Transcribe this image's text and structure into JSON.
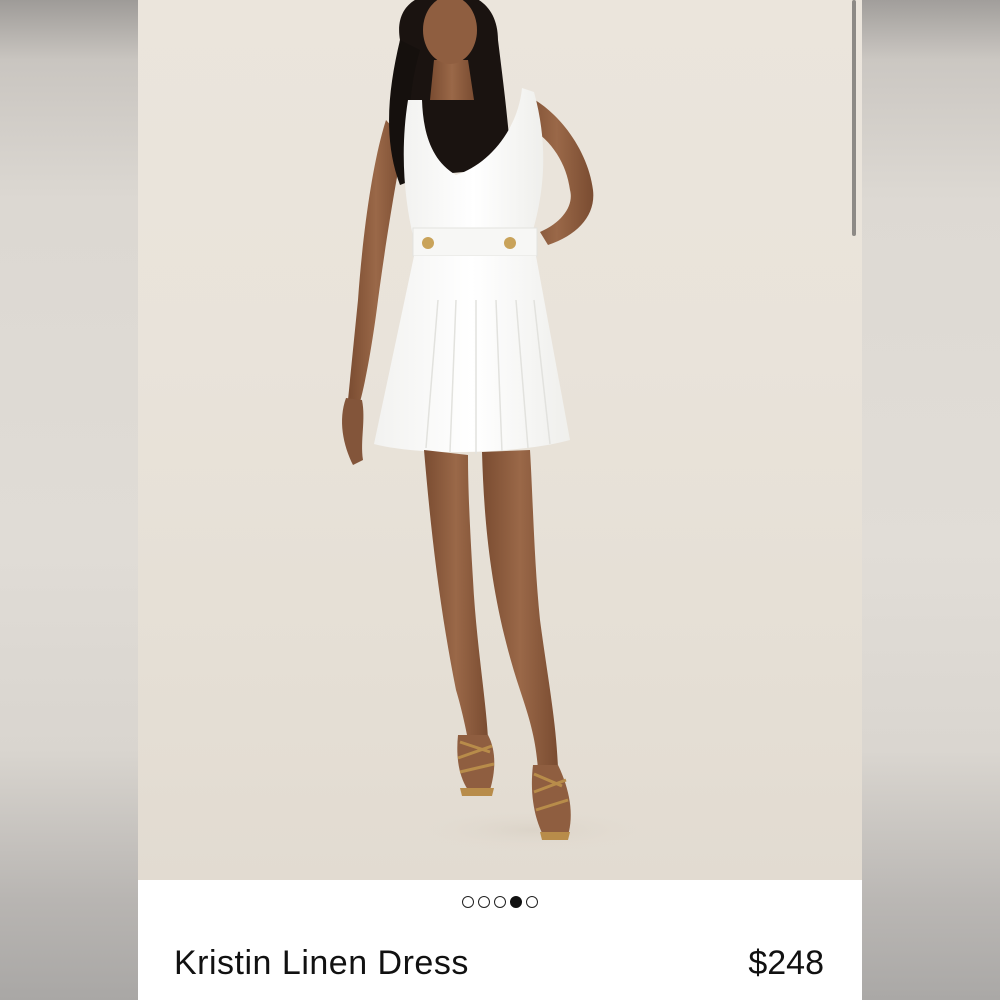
{
  "product": {
    "name": "Kristin Linen Dress",
    "price": "$248"
  },
  "gallery": {
    "total_images": 5,
    "active_index": 3
  },
  "colors": {
    "backdrop": "#e9e3da",
    "dress": "#ffffff",
    "skin": "#8a5a3c",
    "hair": "#1a1310",
    "sandal": "#b88c4a"
  }
}
